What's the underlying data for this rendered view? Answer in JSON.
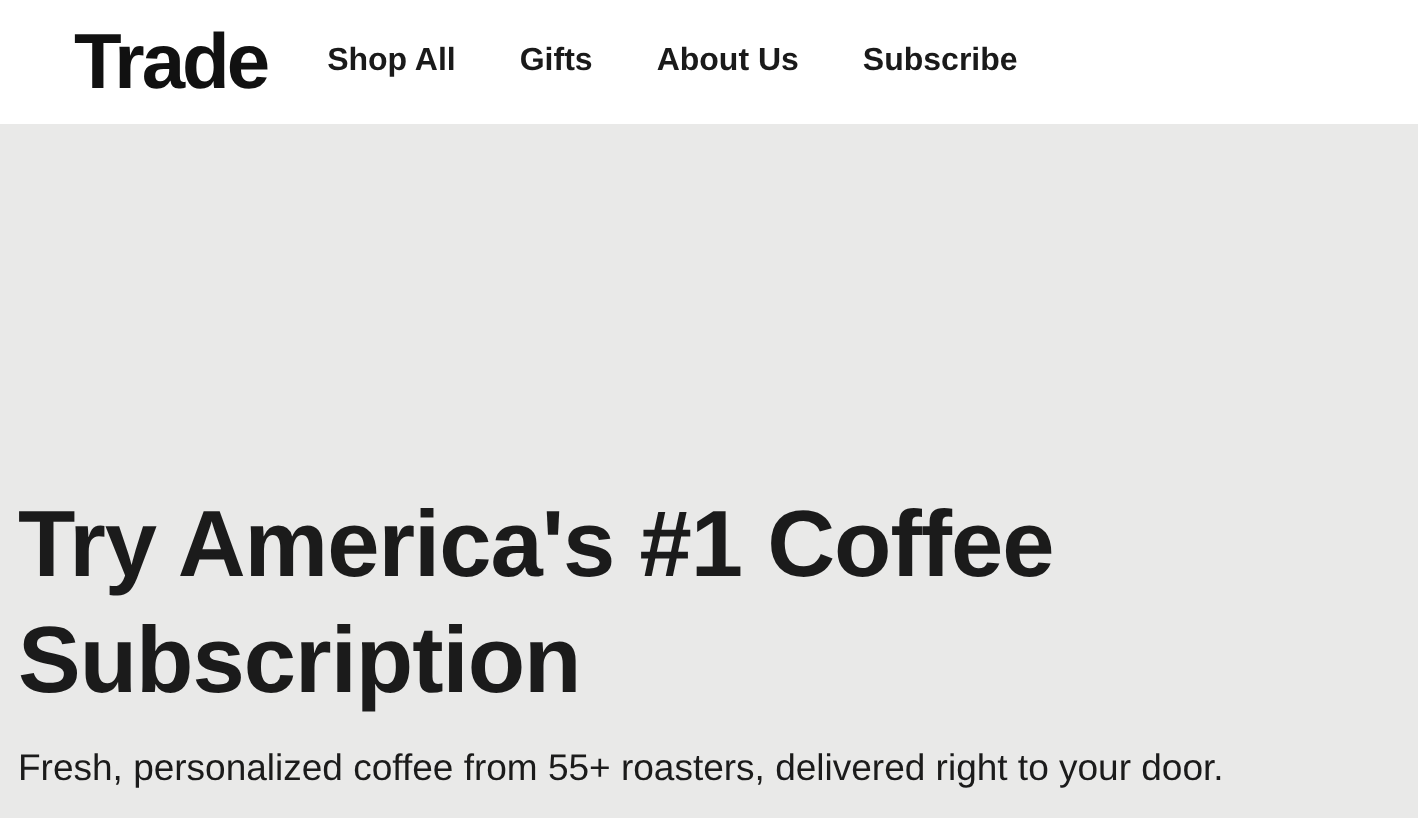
{
  "header": {
    "logo": "Trade",
    "nav": [
      "Shop All",
      "Gifts",
      "About Us",
      "Subscribe"
    ]
  },
  "hero": {
    "title_lines": [
      "Try America's #1 Coffee",
      "Subscription"
    ],
    "subtitle": "Fresh, personalized coffee from 55+ roasters, delivered right to your door."
  }
}
